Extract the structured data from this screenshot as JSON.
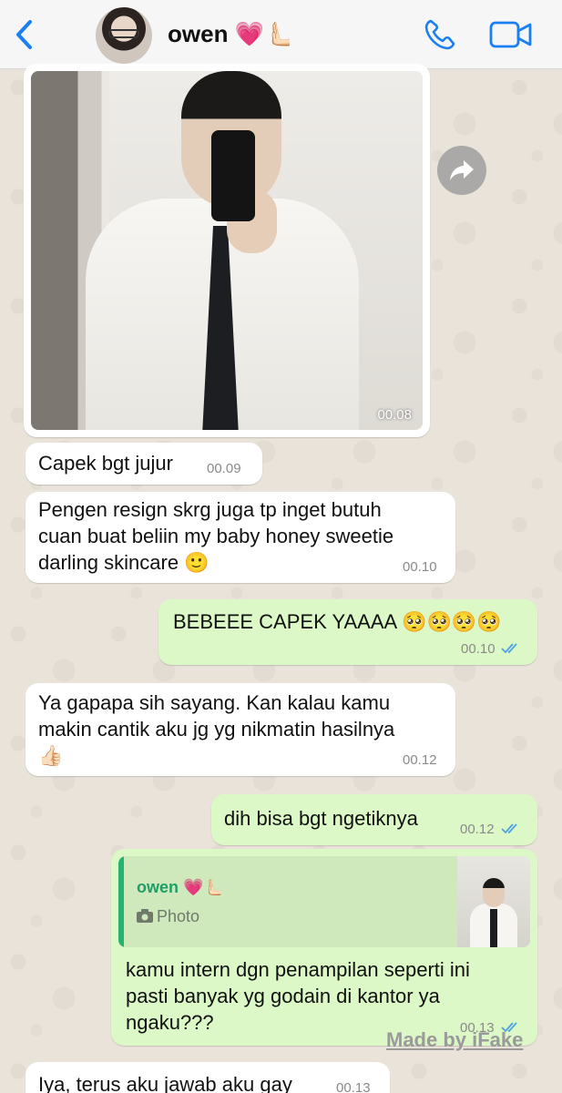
{
  "header": {
    "contact_name": "owen 💗🫷🏻",
    "back_icon": "chevron-left-icon",
    "call_icon": "phone-icon",
    "video_icon": "video-camera-icon",
    "accent_color": "#1a7ff0"
  },
  "messages": [
    {
      "type": "image",
      "direction": "incoming",
      "time": "00.08"
    },
    {
      "type": "text",
      "direction": "incoming",
      "text": "Capek bgt jujur",
      "time": "00.09"
    },
    {
      "type": "text",
      "direction": "incoming",
      "lines": [
        "Pengen resign skrg juga tp inget butuh",
        "cuan buat beliin my baby honey sweetie",
        "darling skincare 🙂"
      ],
      "time": "00.10"
    },
    {
      "type": "text",
      "direction": "outgoing",
      "text": "BEBEEE CAPEK YAAAA 🥺🥺🥺🥺",
      "time": "00.10",
      "status": "read"
    },
    {
      "type": "text",
      "direction": "incoming",
      "lines": [
        "Ya gapapa sih sayang. Kan kalau kamu",
        "makin cantik aku jg yg nikmatin hasilnya",
        "👍🏻"
      ],
      "time": "00.12"
    },
    {
      "type": "text",
      "direction": "outgoing",
      "text": "dih bisa bgt ngetiknya",
      "time": "00.12",
      "status": "read"
    },
    {
      "type": "reply",
      "direction": "outgoing",
      "quote": {
        "name": "owen 💗🫷🏻",
        "kind": "Photo"
      },
      "lines": [
        "kamu intern dgn penampilan seperti ini",
        "pasti banyak yg godain di kantor ya",
        "ngaku???"
      ],
      "time": "00.13",
      "status": "read"
    },
    {
      "type": "text",
      "direction": "incoming",
      "text": "Iya, terus aku jawab aku gay",
      "time": "00.13"
    }
  ],
  "watermark": "Made by iFake",
  "colors": {
    "incoming": "#ffffff",
    "outgoing": "#dcf8c6",
    "read_ticks": "#4fa3e0",
    "quote_name": "#1f9e67"
  }
}
